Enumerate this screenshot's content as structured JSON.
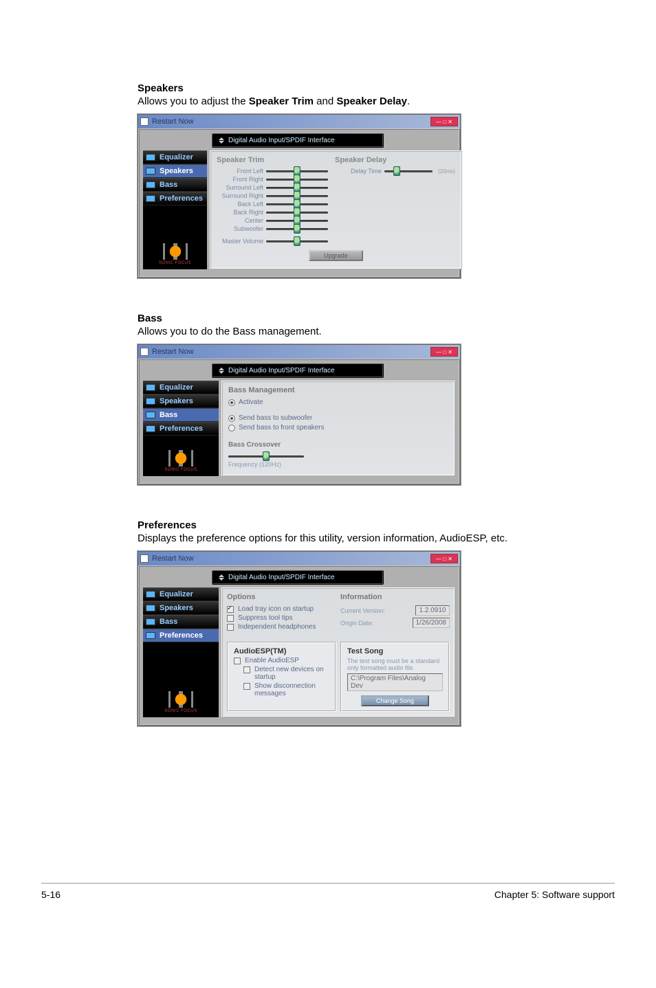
{
  "doc": {
    "sections": {
      "speakers": {
        "title": "Speakers",
        "desc_pre": "Allows you to adjust the ",
        "b1": "Speaker Trim",
        "mid": " and ",
        "b2": "Speaker Delay",
        "post": "."
      },
      "bass": {
        "title": "Bass",
        "desc": "Allows you to do the Bass management."
      },
      "prefs": {
        "title": "Preferences",
        "desc": "Displays the preference options for this utility, version information, AudioESP, etc."
      }
    },
    "footer": {
      "left": "5-16",
      "right": "Chapter 5: Software support"
    }
  },
  "win": {
    "title": "Restart Now",
    "breadcrumb": "Digital Audio Input/SPDIF Interface",
    "tabs": {
      "equalizer": "Equalizer",
      "speakers": "Speakers",
      "bass": "Bass",
      "preferences": "Preferences"
    },
    "logo": "SONIC FOCUS"
  },
  "speakers_panel": {
    "trim_title": "Speaker Trim",
    "delay_title": "Speaker Delay",
    "sliders": {
      "front_left": "Front Left",
      "front_right": "Front Right",
      "surround_left": "Surround Left",
      "surround_right": "Surround Right",
      "back_left": "Back Left",
      "back_right": "Back Right",
      "center": "Center",
      "subwoofer": "Subwoofer",
      "master": "Master Volume"
    },
    "delay_slider": "Delay Time",
    "delay_unit": "(20ms)",
    "upgrade": "Upgrade"
  },
  "bass_panel": {
    "title": "Bass Management",
    "activate": "Activate",
    "opt1": "Send bass to subwoofer",
    "opt2": "Send bass to front speakers",
    "cross_title": "Bass Crossover",
    "freq": "Frequency (120Hz)"
  },
  "prefs_panel": {
    "options_title": "Options",
    "opt_tray": "Load tray icon on startup",
    "opt_tips": "Suppress tool tips",
    "opt_ind": "Independent headphones",
    "info_title": "Information",
    "ver_label": "Current Version:",
    "ver_val": "1.2.0910",
    "date_label": "Origin Date:",
    "date_val": "1/26/2008",
    "esp_title": "AudioESP(TM)",
    "esp_enable": "Enable AudioESP",
    "esp_detect": "Detect new devices on startup",
    "esp_msg": "Show disconnection messages",
    "test_title": "Test Song",
    "test_desc": "The test song must be a standard only formatted audio file.",
    "test_path": "C:\\Program Files\\Analog Dev",
    "change": "Change Song"
  }
}
